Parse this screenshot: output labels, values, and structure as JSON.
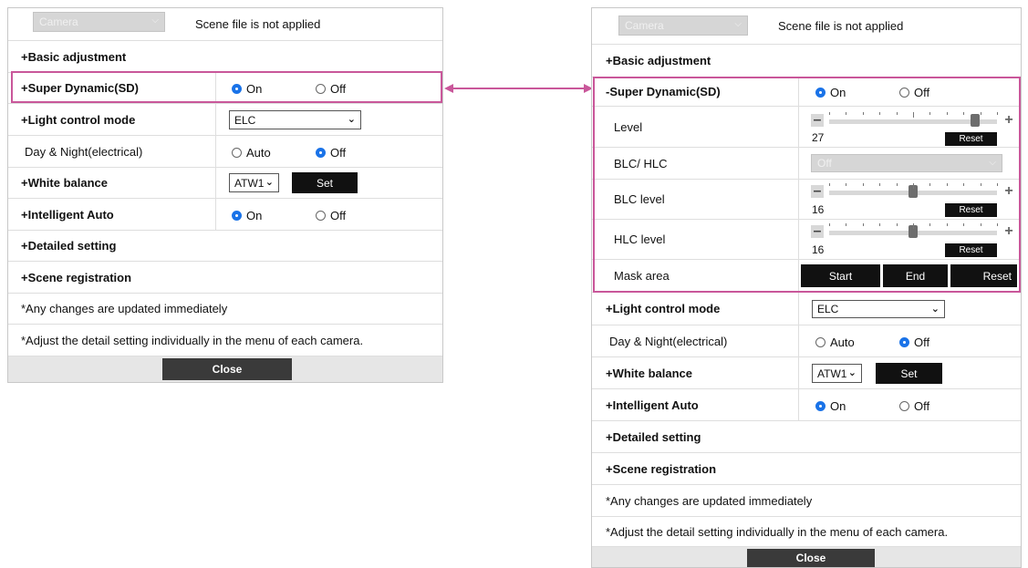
{
  "colors": {
    "highlight": "#c9579a",
    "radio_on": "#1a73e8",
    "button": "#111111"
  },
  "left": {
    "camera_select": "Camera",
    "scene_status": "Scene file is not applied",
    "basic_adjustment": "+Basic adjustment",
    "super_dynamic": {
      "label": "+Super Dynamic(SD)",
      "on": "On",
      "off": "Off",
      "selected": "On"
    },
    "light_control": {
      "label": "+Light control mode",
      "value": "ELC"
    },
    "day_night": {
      "label": "Day & Night(electrical)",
      "auto": "Auto",
      "off": "Off",
      "selected": "Off"
    },
    "white_balance": {
      "label": "+White balance",
      "value": "ATW1",
      "set": "Set"
    },
    "intelligent_auto": {
      "label": "+Intelligent Auto",
      "on": "On",
      "off": "Off",
      "selected": "On"
    },
    "detailed_setting": "+Detailed setting",
    "scene_registration": "+Scene registration",
    "note1": "*Any changes are updated immediately",
    "note2": "*Adjust the detail setting individually in the menu of each camera.",
    "close": "Close"
  },
  "right": {
    "camera_select": "Camera",
    "scene_status": "Scene file is not applied",
    "basic_adjustment": "+Basic adjustment",
    "super_dynamic": {
      "label": "-Super Dynamic(SD)",
      "on": "On",
      "off": "Off",
      "selected": "On"
    },
    "level": {
      "label": "Level",
      "value": "27",
      "reset": "Reset",
      "fraction": 0.87
    },
    "blc_hlc": {
      "label": "BLC/ HLC",
      "value": "Off"
    },
    "blc_level": {
      "label": "BLC level",
      "value": "16",
      "reset": "Reset",
      "fraction": 0.5
    },
    "hlc_level": {
      "label": "HLC level",
      "value": "16",
      "reset": "Reset",
      "fraction": 0.5
    },
    "mask_area": {
      "label": "Mask area",
      "start": "Start",
      "end": "End",
      "reset": "Reset"
    },
    "light_control": {
      "label": "+Light control mode",
      "value": "ELC"
    },
    "day_night": {
      "label": "Day & Night(electrical)",
      "auto": "Auto",
      "off": "Off",
      "selected": "Off"
    },
    "white_balance": {
      "label": "+White balance",
      "value": "ATW1",
      "set": "Set"
    },
    "intelligent_auto": {
      "label": "+Intelligent Auto",
      "on": "On",
      "off": "Off",
      "selected": "On"
    },
    "detailed_setting": "+Detailed setting",
    "scene_registration": "+Scene registration",
    "note1": "*Any changes are updated immediately",
    "note2": "*Adjust the detail setting individually in the menu of each camera.",
    "close": "Close"
  }
}
